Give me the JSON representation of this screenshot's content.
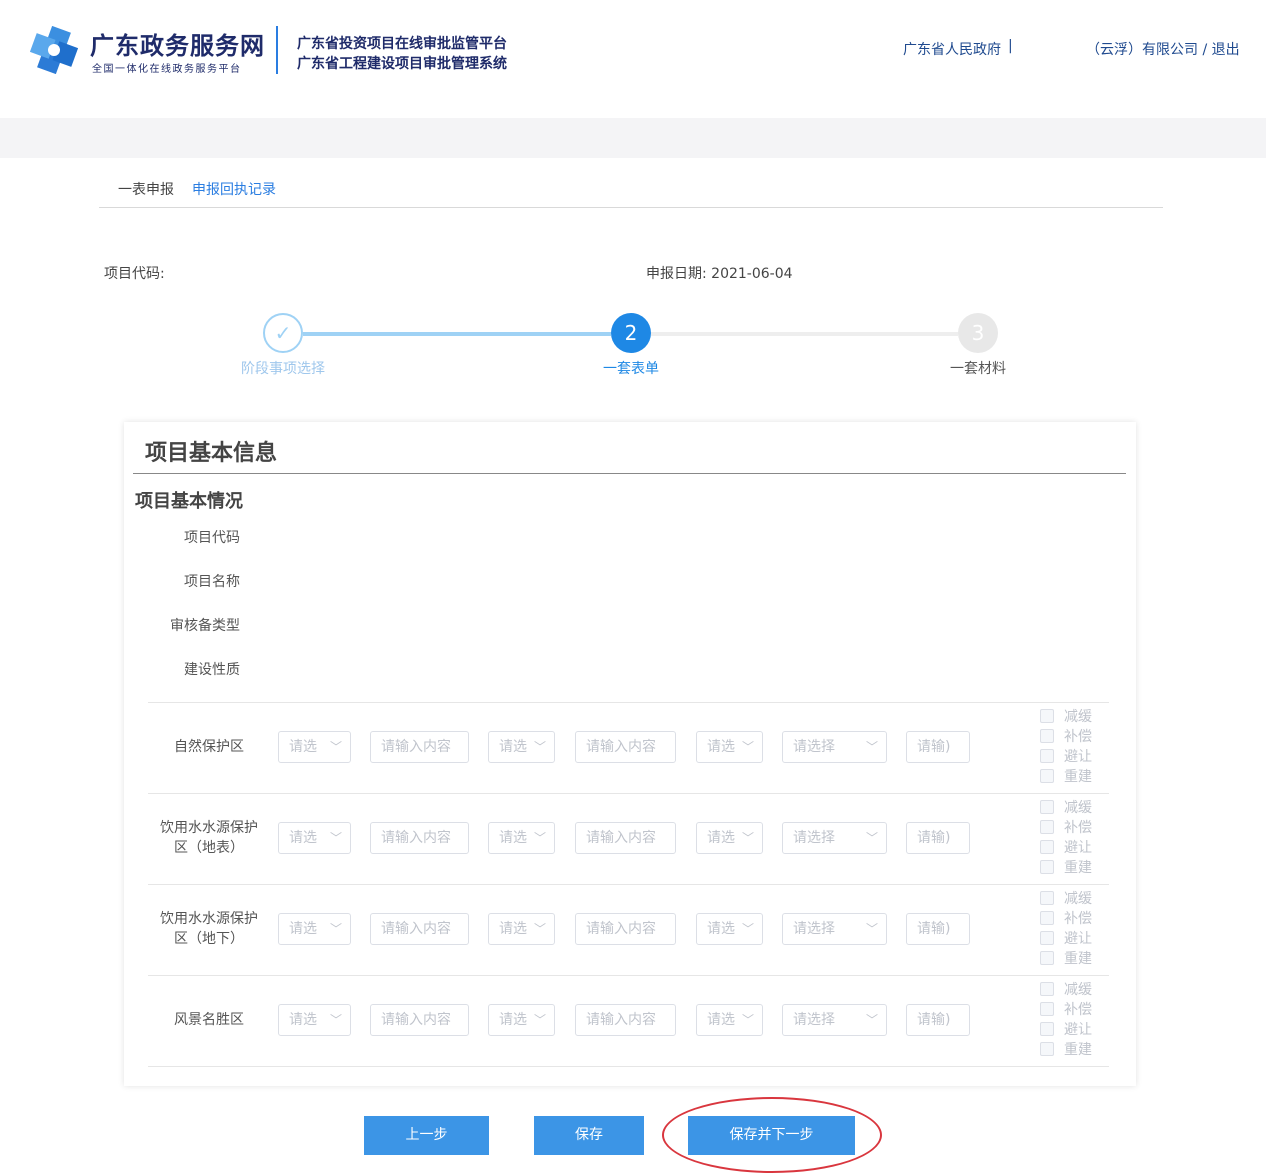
{
  "header": {
    "logo_title": "广东政务服务网",
    "logo_subtitle": "全国一体化在线政务服务平台",
    "platform_line1": "广东省投资项目在线审批监管平台",
    "platform_line2": "广东省工程建设项目审批管理系统",
    "gov_link": "广东省人民政府",
    "separator": "|",
    "user_link": "（云浮）有限公司 / 退出"
  },
  "tabs": [
    {
      "label": "一表申报",
      "active": false
    },
    {
      "label": "申报回执记录",
      "active": true
    }
  ],
  "meta": {
    "project_code_label": "项目代码:",
    "apply_date_label": "申报日期: 2021-06-04"
  },
  "steps": [
    {
      "number": "✓",
      "label": "阶段事项选择",
      "status": "done"
    },
    {
      "number": "2",
      "label": "一套表单",
      "status": "active"
    },
    {
      "number": "3",
      "label": "一套材料",
      "status": "pending"
    }
  ],
  "form": {
    "title": "项目基本信息",
    "section_title": "项目基本情况",
    "fields": [
      {
        "label": "项目代码"
      },
      {
        "label": "项目名称"
      },
      {
        "label": "审核备类型"
      },
      {
        "label": "建设性质"
      }
    ],
    "controls": {
      "select_short": "请选",
      "select_short_2": "请选",
      "select_long": "请选择",
      "input_content": "请输入内容",
      "input_short": "请输)"
    },
    "checkbox_options": [
      "减缓",
      "补偿",
      "避让",
      "重建"
    ],
    "rows": [
      {
        "label": "自然保护区"
      },
      {
        "label": "饮用水水源保护区（地表）"
      },
      {
        "label": "饮用水水源保护区（地下）"
      },
      {
        "label": "风景名胜区"
      }
    ]
  },
  "buttons": {
    "prev": "上一步",
    "save": "保存",
    "save_next": "保存并下一步"
  },
  "colors": {
    "primary": "#1e88e5",
    "button": "#3c95e6",
    "highlight": "#d9363e"
  }
}
